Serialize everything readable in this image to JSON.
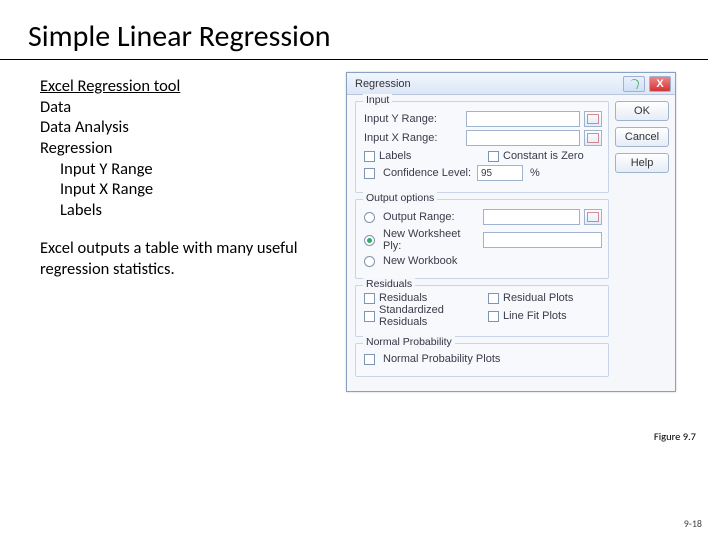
{
  "slide": {
    "title": "Simple Linear Regression",
    "figure_caption": "Figure 9.7",
    "page_number": "9-18"
  },
  "notes": {
    "heading": "Excel Regression tool",
    "lines": [
      "Data",
      "Data Analysis",
      "Regression"
    ],
    "indent_lines": [
      "Input Y Range",
      "Input X Range",
      "Labels"
    ],
    "paragraph": "Excel outputs a table with many useful regression statistics."
  },
  "dialog": {
    "title": "Regression",
    "buttons": {
      "ok": "OK",
      "cancel": "Cancel",
      "help": "Help"
    },
    "input": {
      "group": "Input",
      "y_label": "Input Y Range:",
      "x_label": "Input X Range:",
      "labels_cb": "Labels",
      "const_zero_cb": "Constant is Zero",
      "conf_level_cb": "Confidence Level:",
      "conf_level_val": "95",
      "conf_level_unit": "%"
    },
    "output": {
      "group": "Output options",
      "output_range": "Output Range:",
      "new_ws": "New Worksheet Ply:",
      "new_wb": "New Workbook"
    },
    "residuals": {
      "group": "Residuals",
      "residuals_cb": "Residuals",
      "std_residuals_cb": "Standardized Residuals",
      "residual_plots_cb": "Residual Plots",
      "line_fit_plots_cb": "Line Fit Plots"
    },
    "normal": {
      "group": "Normal Probability",
      "plots_cb": "Normal Probability Plots"
    }
  }
}
